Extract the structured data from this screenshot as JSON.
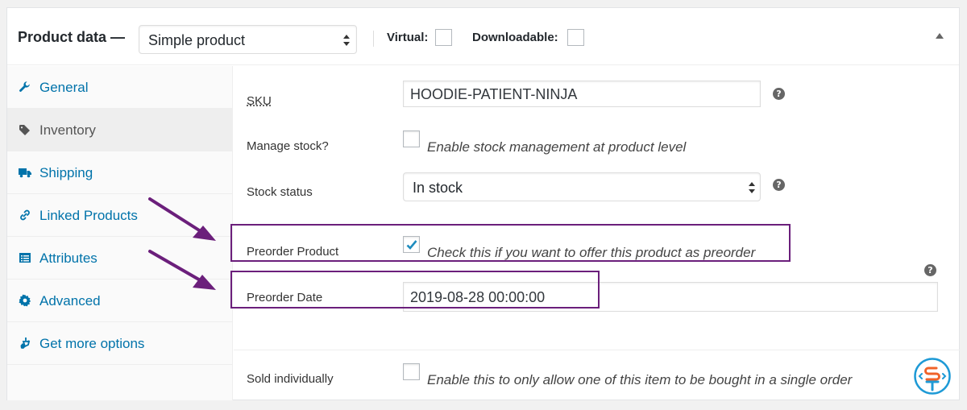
{
  "header": {
    "title": "Product data —",
    "product_type": "Simple product",
    "virtual_label": "Virtual:",
    "downloadable_label": "Downloadable:"
  },
  "sidebar": {
    "items": [
      {
        "label": "General",
        "icon": "wrench-icon"
      },
      {
        "label": "Inventory",
        "icon": "tag-icon",
        "active": true
      },
      {
        "label": "Shipping",
        "icon": "truck-icon"
      },
      {
        "label": "Linked Products",
        "icon": "link-icon"
      },
      {
        "label": "Attributes",
        "icon": "list-icon"
      },
      {
        "label": "Advanced",
        "icon": "gear-icon"
      },
      {
        "label": "Get more options",
        "icon": "plugin-icon"
      }
    ]
  },
  "fields": {
    "sku": {
      "label": "SKU",
      "value": "HOODIE-PATIENT-NINJA"
    },
    "manage_stock": {
      "label": "Manage stock?",
      "description": "Enable stock management at product level",
      "checked": false
    },
    "stock_status": {
      "label": "Stock status",
      "value": "In stock"
    },
    "preorder_product": {
      "label": "Preorder Product",
      "description": "Check this if you want to offer this product as preorder",
      "checked": true
    },
    "preorder_date": {
      "label": "Preorder Date",
      "value": "2019-08-28 00:00:00"
    },
    "sold_individually": {
      "label": "Sold individually",
      "description": "Enable this to only allow one of this item to be bought in a single order",
      "checked": false
    }
  },
  "help_glyph": "?",
  "colors": {
    "link": "#0073aa",
    "highlight": "#6b1f7b",
    "checkmark": "#1e8cbe",
    "logo": "#1e9ad6",
    "logo_accent": "#f0632a"
  }
}
